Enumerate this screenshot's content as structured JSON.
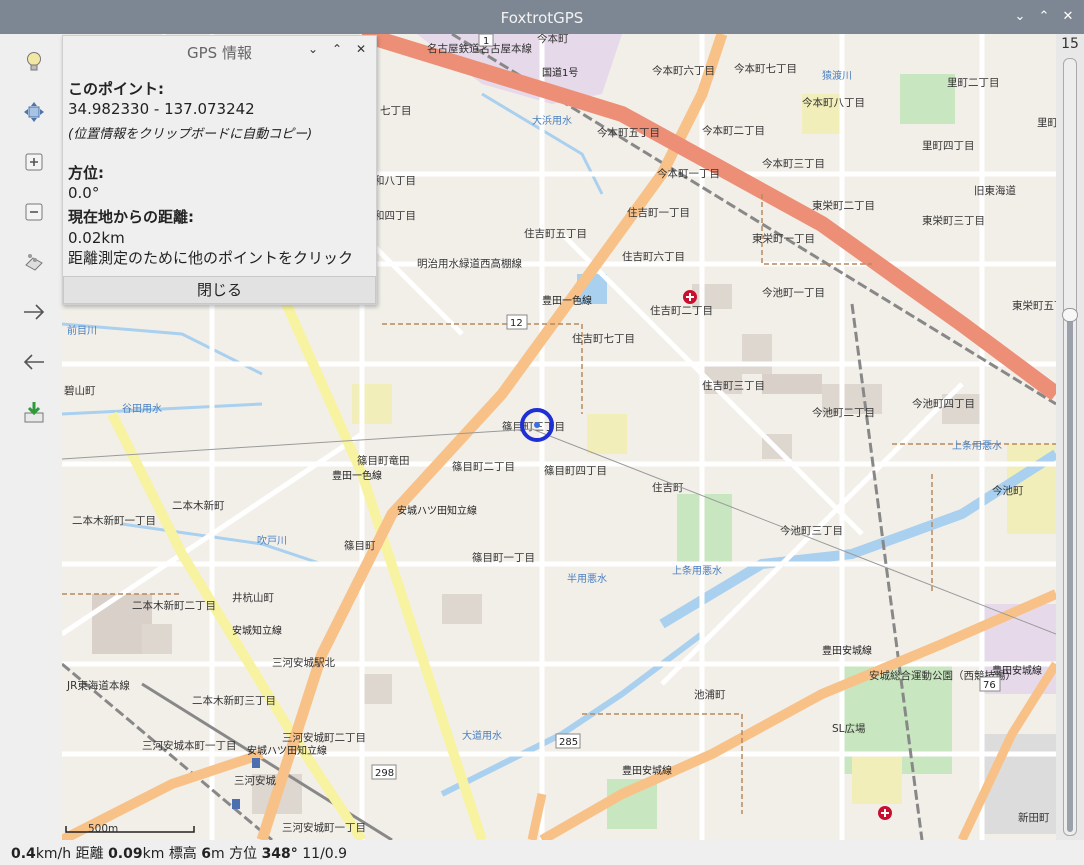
{
  "window": {
    "title": "FoxtrotGPS"
  },
  "toolbar": {
    "icons": [
      "lightbulb-icon",
      "move-icon",
      "zoom-in-icon",
      "zoom-out-icon",
      "waypoint-icon",
      "forward-arrow-icon",
      "back-arrow-icon",
      "download-icon"
    ]
  },
  "zoom": {
    "level": "15",
    "slider_fraction": 0.66
  },
  "gps_dialog": {
    "title": "GPS 情報",
    "point_heading": "このポイント:",
    "coordinates": "34.982330 - 137.073242",
    "clipboard_note": "(位置情報をクリップボードに自動コピー)",
    "bearing_heading": "方位:",
    "bearing_value": "0.0°",
    "distance_heading": "現在地からの距離:",
    "distance_value": "0.02km",
    "instruction": "距離測定のために他のポイントをクリック",
    "close_button": "閉じる"
  },
  "map": {
    "scale_label": "500m",
    "labels": {
      "l1": "今本町",
      "l2": "今本町七丁目",
      "l3": "今本町六丁目",
      "l4": "今本町八丁目",
      "l5": "今本町五丁目",
      "l6": "今本町二丁目",
      "l7": "今本町一丁目",
      "l8": "今本町三丁目",
      "l9": "里町二丁目",
      "l10": "里町四丁目",
      "l11": "里町",
      "l12": "東栄町二丁目",
      "l13": "東栄町三丁目",
      "l14": "東栄町一丁目",
      "l15": "東栄町五丁目",
      "l16": "今池町一丁目",
      "l17": "今池町二丁目",
      "l18": "今池町四丁目",
      "l19": "今池町三丁目",
      "l20": "今池町",
      "l21": "住吉町五丁目",
      "l22": "住吉町一丁目",
      "l23": "住吉町六丁目",
      "l24": "住吉町七丁目",
      "l25": "住吉町三丁目",
      "l26": "住吉町二丁目",
      "l27": "住吉町",
      "l28": "篠目町三丁目",
      "l29": "篠目町二丁目",
      "l30": "篠目町四丁目",
      "l31": "篠目町一丁目",
      "l32": "篠目町竜田",
      "l33": "篠目町",
      "l34": "二本木新町一丁目",
      "l35": "二本木新町",
      "l36": "二本木新町二丁目",
      "l37": "二本木新町三丁目",
      "l38": "井杭山町",
      "l39": "三河安城駅北",
      "l40": "三河安城町二丁目",
      "l41": "三河安城本町一丁目",
      "l42": "三河安城町一丁目",
      "l43": "三河安城",
      "l44": "池浦町",
      "l45": "安城総合運動公園（西競技場）",
      "l46": "SL広場",
      "l47": "新田町",
      "l48": "和八丁目",
      "l49": "和四丁目",
      "l50": "七丁目",
      "l51": "旧東海道",
      "l52": "明治用水緑道西高棚線",
      "l53": "谷田用水",
      "l54": "上条用悪水",
      "l55": "吹戸川",
      "l56": "上条用悪水",
      "l57": "大道用水",
      "l58": "猿渡川",
      "l59": "前目川",
      "l60": "大浜用水",
      "l61": "半用悪水",
      "l62": "JR東海道本線",
      "l63": "名古屋鉄道名古屋本線",
      "l64": "碧山町"
    },
    "roads": {
      "r1": "国道1号",
      "r2": "豊田一色線",
      "r3": "安城ハツ田知立線",
      "r4": "安城知立線",
      "r5": "豊田安城線",
      "r6": "豊田安城線",
      "r7": "豊田一色線",
      "r8": "安城ハツ田知立線",
      "r9": "豊田安城線"
    },
    "shields": {
      "s1": "12",
      "s2": "285",
      "s3": "298",
      "s4": "76",
      "s5": "1"
    }
  },
  "status": {
    "speed": "0.4",
    "speed_unit": "km/h",
    "distance_label": "距離",
    "distance": "0.09",
    "distance_unit": "km",
    "altitude_label": "標高",
    "altitude": "6",
    "altitude_unit": "m",
    "heading_label": "方位",
    "heading": "348°",
    "satellites": "11/0.9"
  }
}
